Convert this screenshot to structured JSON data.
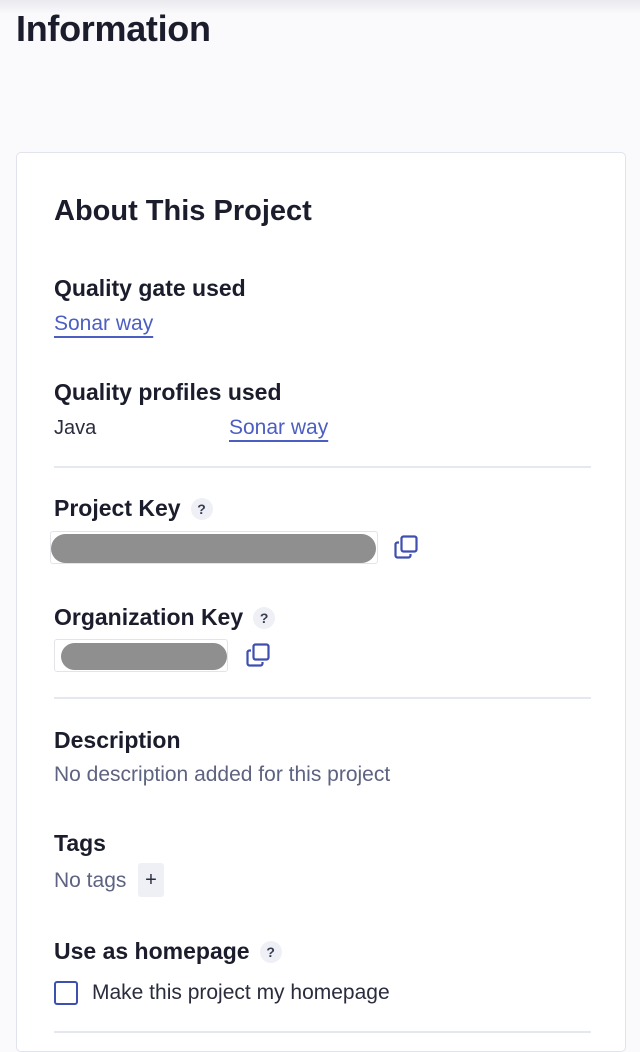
{
  "page": {
    "title": "Information"
  },
  "about": {
    "title": "About This Project",
    "quality_gate": {
      "label": "Quality gate used",
      "value": "Sonar way"
    },
    "quality_profiles": {
      "label": "Quality profiles used",
      "items": [
        {
          "language": "Java",
          "profile": "Sonar way"
        }
      ]
    },
    "project_key": {
      "label": "Project Key",
      "help": "?",
      "value_redacted": true,
      "copy_icon": "copy-icon"
    },
    "organization_key": {
      "label": "Organization Key",
      "help": "?",
      "value_redacted": true,
      "copy_icon": "copy-icon"
    },
    "description": {
      "label": "Description",
      "value": "No description added for this project"
    },
    "tags": {
      "label": "Tags",
      "value": "No tags",
      "add_label": "+"
    },
    "homepage": {
      "label": "Use as homepage",
      "help": "?",
      "checkbox_label": "Make this project my homepage",
      "checked": false
    }
  },
  "colors": {
    "link": "#4c5ec2",
    "muted_text": "#5d6380",
    "heading": "#1b1d2c",
    "checkbox_border": "#3e4fb0"
  }
}
